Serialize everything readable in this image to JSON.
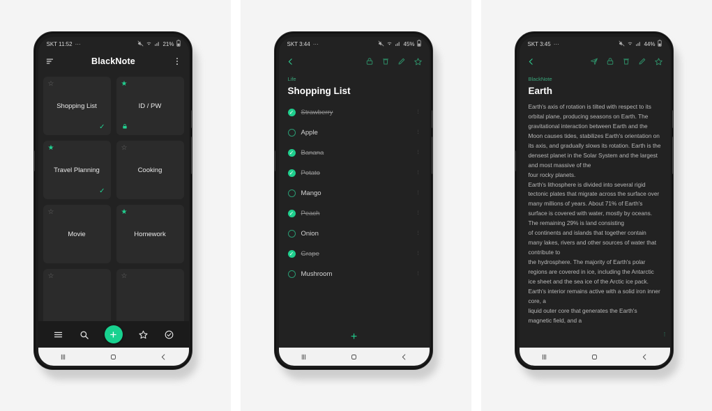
{
  "app": {
    "name": "BlackNote",
    "accent": "#18d18f",
    "screen_bg": "#222222",
    "panel_bg": "#f4f4f4"
  },
  "screens": [
    {
      "id": "notes-grid",
      "statusbar": {
        "carrier_time": "SKT 11:52",
        "dots": "⋯",
        "mute_icon": "mute-icon",
        "wifi_icon": "wifi-icon",
        "signal_icon": "signal-icon",
        "battery": "21%",
        "battery_icon": "battery-icon"
      },
      "toolbar": {
        "menu_icon": "sort-lines-icon",
        "title": "BlackNote",
        "overflow_icon": "more-vertical-icon"
      },
      "notes": [
        {
          "title": "Shopping List",
          "starred": false,
          "checked": true,
          "locked": false
        },
        {
          "title": "ID / PW",
          "starred": true,
          "checked": false,
          "locked": true
        },
        {
          "title": "Travel Planning",
          "starred": true,
          "checked": true,
          "locked": false
        },
        {
          "title": "Cooking",
          "starred": false,
          "checked": false,
          "locked": false
        },
        {
          "title": "Movie",
          "starred": false,
          "checked": false,
          "locked": false
        },
        {
          "title": "Homework",
          "starred": true,
          "checked": false,
          "locked": false
        },
        {
          "title": "",
          "starred": false,
          "checked": false,
          "locked": false
        },
        {
          "title": "",
          "starred": false,
          "checked": false,
          "locked": false
        }
      ],
      "bottombar": {
        "items": [
          {
            "name": "menu-icon",
            "label": "≡"
          },
          {
            "name": "search-icon",
            "label": ""
          },
          {
            "name": "add-note-fab",
            "label": "+"
          },
          {
            "name": "favorites-icon",
            "label": ""
          },
          {
            "name": "checklist-icon",
            "label": ""
          }
        ]
      },
      "navbar": {
        "recents": "recents-icon",
        "home": "home-icon",
        "back": "back-icon"
      }
    },
    {
      "id": "checklist-detail",
      "statusbar": {
        "carrier_time": "SKT 3:44",
        "dots": "⋯",
        "mute_icon": "mute-icon",
        "wifi_icon": "wifi-icon",
        "signal_icon": "signal-icon",
        "battery": "45%",
        "battery_icon": "battery-icon"
      },
      "toolbar": {
        "back_icon": "chevron-left-icon",
        "actions": [
          "lock-icon",
          "trash-icon",
          "edit-pencil-icon",
          "star-icon"
        ]
      },
      "category": "Life",
      "title": "Shopping List",
      "items": [
        {
          "label": "Strawberry",
          "checked": true
        },
        {
          "label": "Apple",
          "checked": false
        },
        {
          "label": "Banana",
          "checked": true
        },
        {
          "label": "Potato",
          "checked": true
        },
        {
          "label": "Mango",
          "checked": false
        },
        {
          "label": "Peach",
          "checked": true
        },
        {
          "label": "Onion",
          "checked": false
        },
        {
          "label": "Grape",
          "checked": true
        },
        {
          "label": "Mushroom",
          "checked": false
        }
      ],
      "add_item_label": "+",
      "navbar": {
        "recents": "recents-icon",
        "home": "home-icon",
        "back": "back-icon"
      }
    },
    {
      "id": "text-note-detail",
      "statusbar": {
        "carrier_time": "SKT 3:45",
        "dots": "⋯",
        "mute_icon": "mute-icon",
        "wifi_icon": "wifi-icon",
        "signal_icon": "signal-icon",
        "battery": "44%",
        "battery_icon": "battery-icon"
      },
      "toolbar": {
        "back_icon": "chevron-left-icon",
        "actions": [
          "send-icon",
          "lock-icon",
          "trash-icon",
          "edit-pencil-icon",
          "star-icon"
        ]
      },
      "category": "BlackNote",
      "title": "Earth",
      "body": "Earth's axis of rotation is tilted with respect to its orbital plane, producing seasons on Earth. The gravitational interaction between Earth and the Moon causes tides, stabilizes Earth's orientation on its axis, and gradually slows its rotation. Earth is the densest planet in the Solar System and the largest and most massive of the\nfour rocky planets.\nEarth's lithosphere is divided into several rigid tectonic plates that migrate across the surface over many millions of years. About 71% of Earth's surface is covered with water, mostly by oceans. The remaining 29% is land consisting\nof continents and islands that together contain many lakes, rivers and other sources of water that contribute to\nthe hydrosphere. The majority of Earth's polar regions are covered in ice, including the Antarctic ice sheet and the sea ice of the Arctic ice pack. Earth's interior remains active with a solid iron inner core, a\nliquid outer core that generates the Earth's magnetic field, and a",
      "navbar": {
        "recents": "recents-icon",
        "home": "home-icon",
        "back": "back-icon"
      }
    }
  ]
}
